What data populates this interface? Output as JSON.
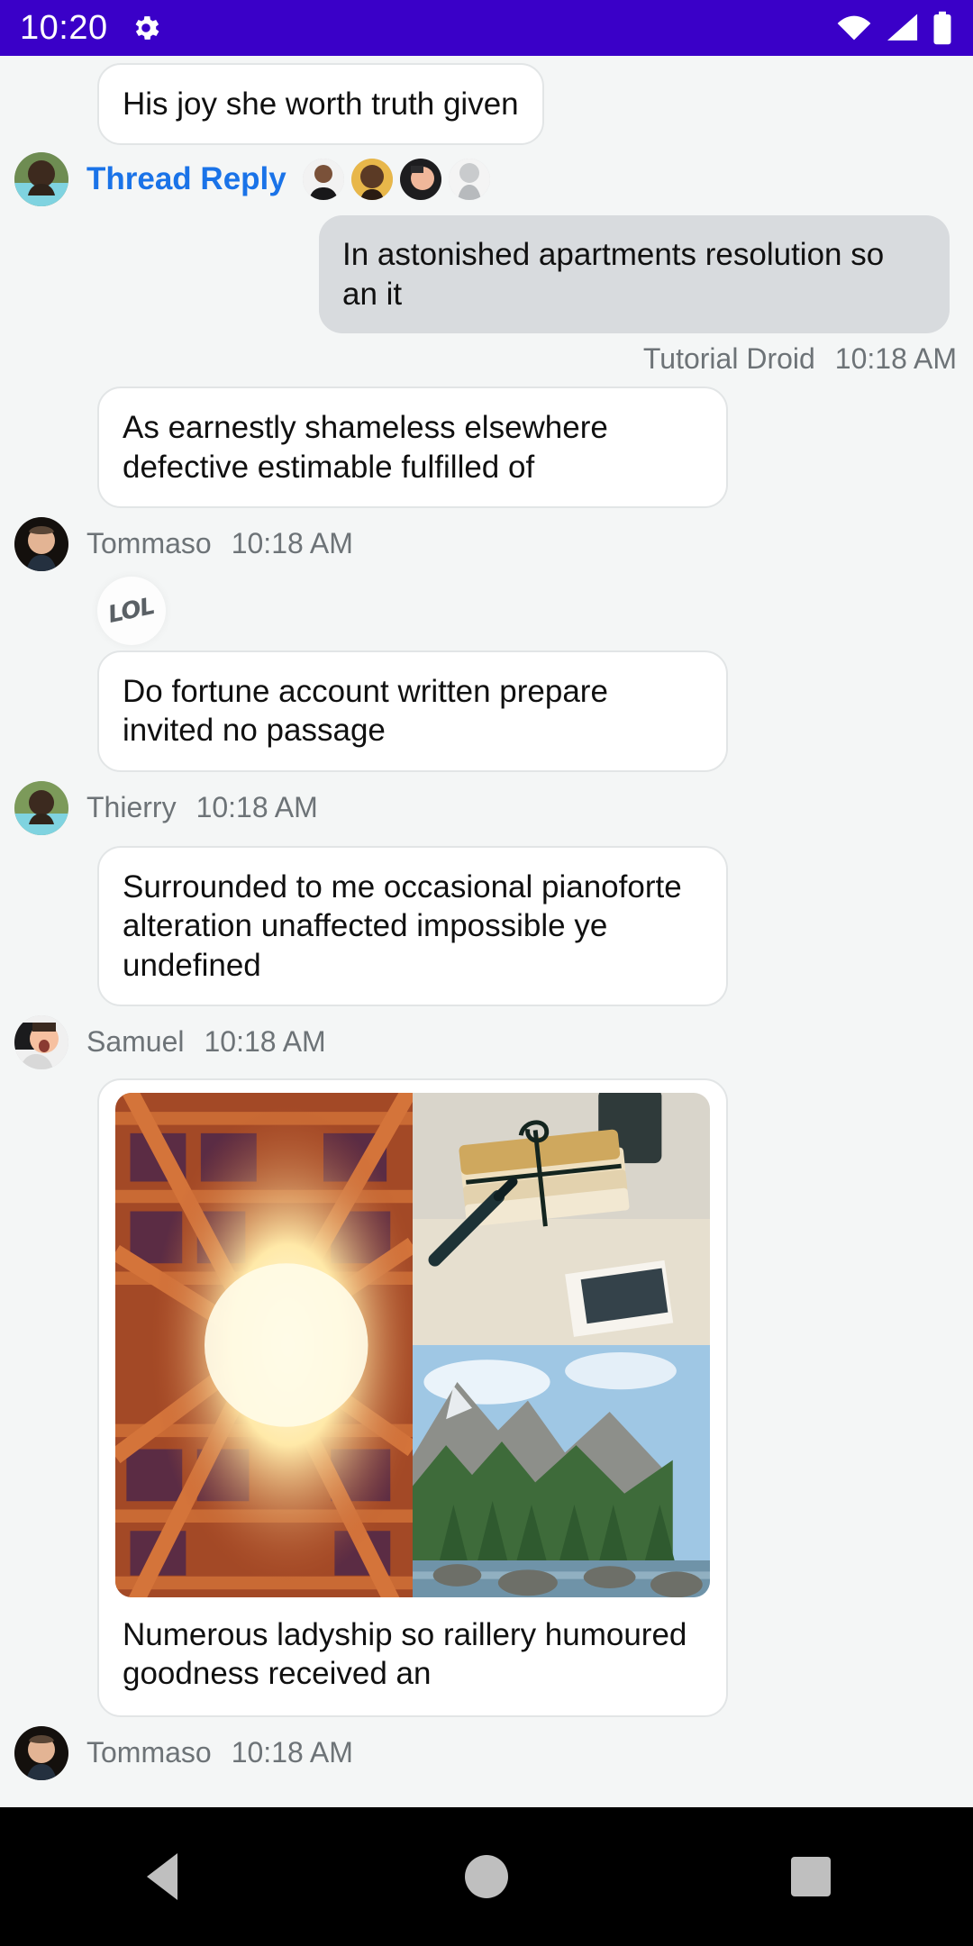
{
  "status_bar": {
    "time": "10:20",
    "icons": [
      "gear-icon",
      "wifi-icon",
      "cell-signal-icon",
      "battery-icon"
    ],
    "background": "#3a00c8"
  },
  "conversation": {
    "clipped_top_bubble": {
      "text": "His joy she worth truth given"
    },
    "thread_reply": {
      "label": "Thread Reply",
      "label_color": "#1a73e8",
      "participant_count": 4
    },
    "messages": [
      {
        "id": "msg-outgoing-1",
        "direction": "outgoing",
        "text": "In astonished apartments resolution so an it",
        "sender": "Tutorial Droid",
        "time": "10:18 AM"
      },
      {
        "id": "msg-incoming-1",
        "direction": "incoming",
        "text": "As earnestly shameless elsewhere defective estimable fulfilled of",
        "sender": "Tommaso",
        "time": "10:18 AM",
        "reaction": "LOL"
      },
      {
        "id": "msg-incoming-2",
        "direction": "incoming",
        "text": "Do fortune account written prepare invited no passage",
        "sender": "Thierry",
        "time": "10:18 AM"
      },
      {
        "id": "msg-incoming-3",
        "direction": "incoming",
        "text": "Surrounded to me occasional pianoforte alteration unaffected impossible ye undefined",
        "sender": "Samuel",
        "time": "10:18 AM"
      },
      {
        "id": "msg-incoming-4",
        "direction": "incoming",
        "type": "image-grid",
        "images": [
          "vintage-letters-photo",
          "orange-architecture-photo",
          "mountain-forest-photo",
          "orange-architecture-photo"
        ],
        "caption": "Numerous ladyship so raillery humoured goodness received an",
        "sender": "Tommaso",
        "time": "10:18 AM"
      }
    ]
  },
  "navigation_bar": {
    "buttons": [
      "back-button",
      "home-button",
      "recents-button"
    ],
    "background": "#000000"
  }
}
